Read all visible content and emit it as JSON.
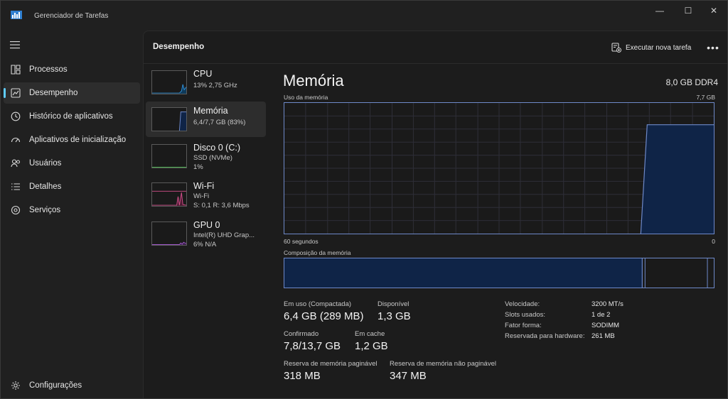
{
  "window": {
    "title": "Gerenciador de Tarefas",
    "controls": {
      "minimize": "—",
      "maximize": "☐",
      "close": "✕"
    }
  },
  "nav": {
    "items": [
      {
        "label": "Processos",
        "icon": "processes-grid-icon"
      },
      {
        "label": "Desempenho",
        "icon": "performance-chart-icon",
        "active": true
      },
      {
        "label": "Histórico de aplicativos",
        "icon": "history-clock-icon"
      },
      {
        "label": "Aplicativos de inicialização",
        "icon": "startup-gauge-icon"
      },
      {
        "label": "Usuários",
        "icon": "users-icon"
      },
      {
        "label": "Detalhes",
        "icon": "details-list-icon"
      },
      {
        "label": "Serviços",
        "icon": "services-puzzle-icon"
      }
    ],
    "settings": {
      "label": "Configurações",
      "icon": "gear-icon"
    }
  },
  "header": {
    "title": "Desempenho",
    "run_task": "Executar nova tarefa",
    "more": "•••"
  },
  "resources": [
    {
      "name": "CPU",
      "sub1": "13% 2,75 GHz",
      "sub2": "",
      "color": "#2e8fd8"
    },
    {
      "name": "Memória",
      "sub1": "6,4/7,7 GB (83%)",
      "sub2": "",
      "color": "#6e89c9",
      "selected": true
    },
    {
      "name": "Disco 0 (C:)",
      "sub1": "SSD (NVMe)",
      "sub2": "1%",
      "color": "#4caf50"
    },
    {
      "name": "Wi-Fi",
      "sub1": "Wi-Fi",
      "sub2": "S: 0,1 R: 3,6 Mbps",
      "color": "#d14f8a"
    },
    {
      "name": "GPU 0",
      "sub1": "Intel(R) UHD Grap...",
      "sub2": "6% N/A",
      "color": "#a057c9"
    }
  ],
  "memory": {
    "title": "Memória",
    "spec": "8,0 GB DDR4",
    "usage_label": "Uso da memória",
    "usage_max": "7,7 GB",
    "axis_left": "60 segundos",
    "axis_right": "0",
    "composition_label": "Composição da memória",
    "stats": {
      "in_use_label": "Em uso (Compactada)",
      "in_use_value": "6,4 GB (289 MB)",
      "available_label": "Disponível",
      "available_value": "1,3 GB",
      "committed_label": "Confirmado",
      "committed_value": "7,8/13,7 GB",
      "cached_label": "Em cache",
      "cached_value": "1,2 GB",
      "paged_label": "Reserva de memória paginável",
      "paged_value": "318 MB",
      "nonpaged_label": "Reserva de memória não paginável",
      "nonpaged_value": "347 MB"
    },
    "specs": [
      {
        "key": "Velocidade:",
        "value": "3200 MT/s"
      },
      {
        "key": "Slots usados:",
        "value": "1 de 2"
      },
      {
        "key": "Fator forma:",
        "value": "SODIMM"
      },
      {
        "key": "Reservada para hardware:",
        "value": "261 MB"
      }
    ]
  },
  "colors": {
    "accent": "#60cdff",
    "memory_line": "#6e89c9",
    "memory_fill": "#0f2447"
  }
}
